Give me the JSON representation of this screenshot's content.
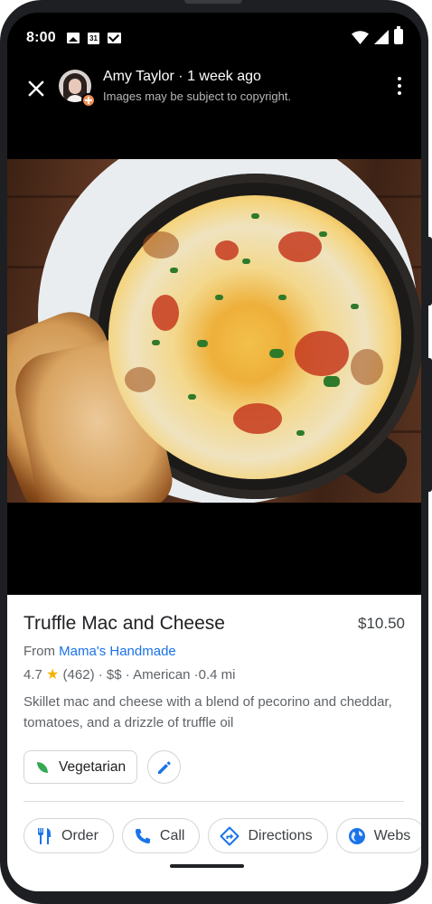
{
  "status_bar": {
    "time": "8:00",
    "calendar_day": "31",
    "notification_icons": [
      "image-icon",
      "calendar-icon",
      "gmail-icon"
    ],
    "system_icons": [
      "wifi-icon",
      "signal-icon",
      "battery-icon"
    ]
  },
  "header": {
    "author": "Amy Taylor",
    "separator": " · ",
    "posted": "1 week ago",
    "subtitle": "Images may be subject to copyright."
  },
  "dish": {
    "name": "Truffle Mac and Cheese",
    "price": "$10.50",
    "from_label": "From",
    "restaurant": "Mama's Handmade",
    "rating": "4.7",
    "review_count": "(462)",
    "price_level": "$$",
    "cuisine": "American",
    "distance": "0.4 mi",
    "description": "Skillet mac and cheese with a blend of pecorino and cheddar, tomatoes, and a drizzle of truffle oil"
  },
  "tags": {
    "diet_label": "Vegetarian"
  },
  "actions": [
    {
      "label": "Order",
      "icon": "fork-knife-icon"
    },
    {
      "label": "Call",
      "icon": "phone-icon"
    },
    {
      "label": "Directions",
      "icon": "directions-icon"
    },
    {
      "label": "Webs",
      "icon": "globe-icon"
    }
  ],
  "colors": {
    "accent_blue": "#1a73e8",
    "star_yellow": "#f4b400",
    "veg_green": "#34a853",
    "avatar_badge": "#f08e53"
  }
}
